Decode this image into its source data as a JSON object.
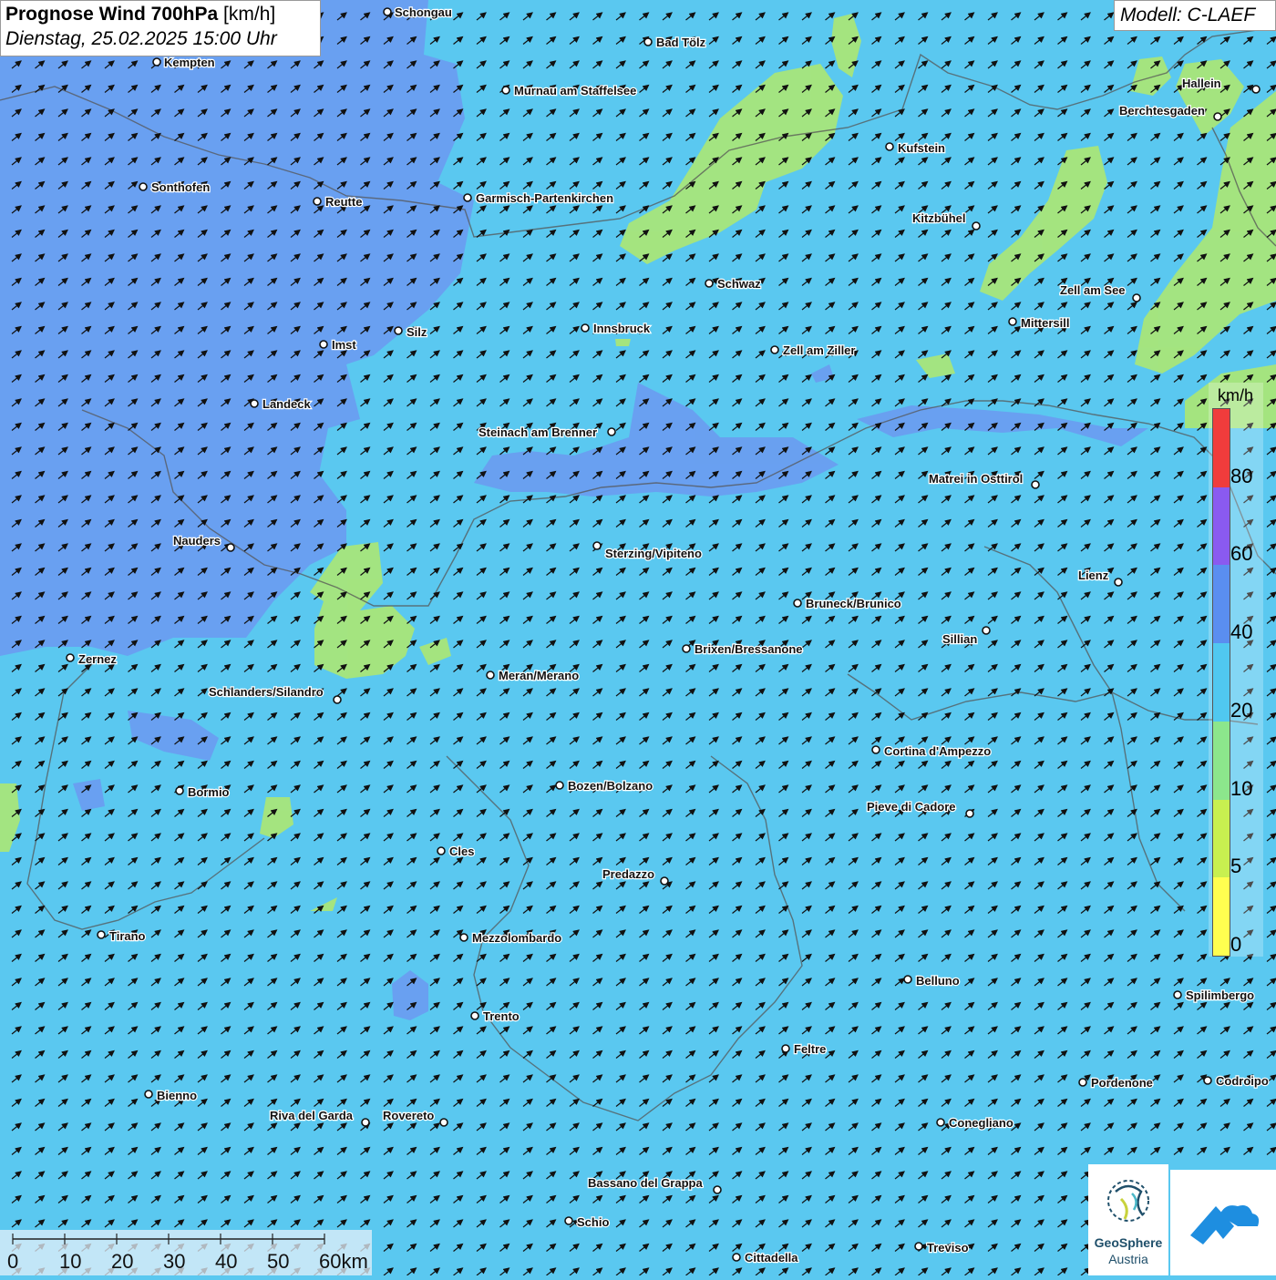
{
  "header": {
    "title_bold": "Prognose Wind 700hPa",
    "title_unit": "[km/h]",
    "datetime": "Dienstag, 25.02.2025 15:00 Uhr",
    "model": "Modell: C-LAEF"
  },
  "legend": {
    "unit": "km/h",
    "ticks": [
      "0",
      "5",
      "10",
      "20",
      "40",
      "60",
      "80"
    ],
    "colors": [
      "#ffff50",
      "#c8f050",
      "#8ce68c",
      "#50c8f0",
      "#5a8ef0",
      "#8a5af0",
      "#f03c3c"
    ]
  },
  "scale_bar": {
    "labels": [
      "0",
      "10",
      "20",
      "30",
      "40",
      "50",
      "60km"
    ]
  },
  "logos": {
    "geosphere_line1": "GeoSphere",
    "geosphere_line2": "Austria"
  },
  "colors": {
    "background": "#5ac8f0",
    "wind_20_40": "#6a9ef0",
    "wind_5_10": "#a8e67a",
    "arrow": "#111111"
  },
  "cities": [
    {
      "name": "Schongau"
    },
    {
      "name": "Bad Tölz"
    },
    {
      "name": "Kempten"
    },
    {
      "name": "Murnau am Staffelsee"
    },
    {
      "name": "Hallein"
    },
    {
      "name": "Berchtesgaden"
    },
    {
      "name": "Kufstein"
    },
    {
      "name": "Sonthofen"
    },
    {
      "name": "Reutte"
    },
    {
      "name": "Garmisch-Partenkirchen"
    },
    {
      "name": "Kitzbühel"
    },
    {
      "name": "Schwaz"
    },
    {
      "name": "Zell am See"
    },
    {
      "name": "Mittersill"
    },
    {
      "name": "Innsbruck"
    },
    {
      "name": "Silz"
    },
    {
      "name": "Imst"
    },
    {
      "name": "Zell am Ziller"
    },
    {
      "name": "Landeck"
    },
    {
      "name": "Steinach am Brenner"
    },
    {
      "name": "Matrei in Osttirol"
    },
    {
      "name": "Nauders"
    },
    {
      "name": "Sterzing/Vipiteno"
    },
    {
      "name": "Lienz"
    },
    {
      "name": "Bruneck/Brunico"
    },
    {
      "name": "Sillian"
    },
    {
      "name": "Brixen/Bressanone"
    },
    {
      "name": "Zernez"
    },
    {
      "name": "Meran/Merano"
    },
    {
      "name": "Schlanders/Silandro"
    },
    {
      "name": "Cortina d'Ampezzo"
    },
    {
      "name": "Bozen/Bolzano"
    },
    {
      "name": "Bormio"
    },
    {
      "name": "Pieve di Cadore"
    },
    {
      "name": "Cles"
    },
    {
      "name": "Predazzo"
    },
    {
      "name": "Tirano"
    },
    {
      "name": "Mezzolombardo"
    },
    {
      "name": "Belluno"
    },
    {
      "name": "Spilimbergo"
    },
    {
      "name": "Trento"
    },
    {
      "name": "Feltre"
    },
    {
      "name": "Pordenone"
    },
    {
      "name": "Codroipo"
    },
    {
      "name": "Bienno"
    },
    {
      "name": "Riva del Garda"
    },
    {
      "name": "Rovereto"
    },
    {
      "name": "Conegliano"
    },
    {
      "name": "Bassano del Grappa"
    },
    {
      "name": "Schio"
    },
    {
      "name": "Treviso"
    },
    {
      "name": "Cittadella"
    }
  ]
}
